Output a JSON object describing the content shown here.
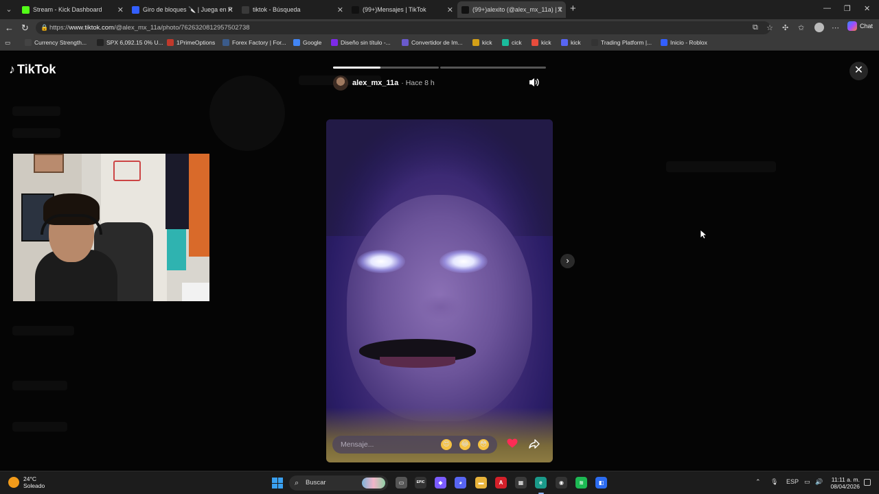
{
  "browser": {
    "tabs": [
      {
        "title": "Stream - Kick Dashboard",
        "icon": "kick-icon",
        "color": "#53fc18"
      },
      {
        "title": "Giro de bloques 🔪 | Juega en Ro",
        "icon": "roblox-icon",
        "color": "#335fff"
      },
      {
        "title": "tiktok - Búsqueda",
        "icon": "search-icon",
        "color": "#3a3a3a"
      },
      {
        "title": "(99+)Mensajes | TikTok",
        "icon": "tiktok-icon",
        "color": "#111111"
      },
      {
        "title": "(99+)alexito (@alex_mx_11a) | Tik",
        "icon": "tiktok-icon",
        "color": "#111111"
      }
    ],
    "active_tab": 4,
    "url_prefix": "https://",
    "url_host": "www.tiktok.com",
    "url_path": "/@alex_mx_11a/photo/7626320812957502738",
    "copilot_label": "Chat",
    "bookmarks": [
      {
        "label": "Currency Strength...",
        "icon": "lc-icon",
        "color": "#444"
      },
      {
        "label": "SPX 6,092.15 0% U...",
        "icon": "tradingview-icon",
        "color": "#222"
      },
      {
        "label": "1PrimeOptions",
        "icon": "primeoptions-icon",
        "color": "#c0392b"
      },
      {
        "label": "Forex Factory | For...",
        "icon": "forexfactory-icon",
        "color": "#3b5b8a"
      },
      {
        "label": "Google",
        "icon": "google-icon",
        "color": "#4285f4"
      },
      {
        "label": "Diseño sin título -...",
        "icon": "canva-icon",
        "color": "#7d2ae8"
      },
      {
        "label": "Convertidor de Im...",
        "icon": "converter-icon",
        "color": "#6a5acd"
      },
      {
        "label": "kick",
        "icon": "kick-icon",
        "color": "#d4a017"
      },
      {
        "label": "cick",
        "icon": "kick-icon",
        "color": "#1abc9c"
      },
      {
        "label": "kick",
        "icon": "kick-icon",
        "color": "#e74c3c"
      },
      {
        "label": "kick",
        "icon": "kick-icon",
        "color": "#5865f2"
      },
      {
        "label": "Trading Platform |...",
        "icon": "trading-platform-icon",
        "color": "#333"
      },
      {
        "label": "Inicio - Roblox",
        "icon": "roblox-icon",
        "color": "#335fff"
      }
    ]
  },
  "tiktok": {
    "logo_text": "TikTok",
    "story": {
      "username": "alex_mx_11a",
      "time": "· Hace 8 h",
      "progress": [
        1.0,
        0.0
      ],
      "first_segment_progress": 0.45,
      "message_placeholder": "Mensaje...",
      "emojis": [
        "😍",
        "😂",
        "😳"
      ]
    }
  },
  "taskbar": {
    "temperature": "24°C",
    "weather": "Soleado",
    "search_label": "Buscar",
    "language": "ESP",
    "time": "11:11 a. m.",
    "date": "08/04/2026",
    "apps": [
      {
        "name": "file-explorer-tb-icon",
        "glyph": "▭",
        "color": "#555"
      },
      {
        "name": "epic-games-tb-icon",
        "glyph": "EPIC",
        "color": "#333"
      },
      {
        "name": "copilot-tb-icon",
        "glyph": "◆",
        "color": "#7b5cff"
      },
      {
        "name": "discord-tb-icon",
        "glyph": "◕",
        "color": "#5865f2"
      },
      {
        "name": "folder-tb-icon",
        "glyph": "▬",
        "color": "#e8b33a"
      },
      {
        "name": "adobe-tb-icon",
        "glyph": "A",
        "color": "#d4202a"
      },
      {
        "name": "store-tb-icon",
        "glyph": "▦",
        "color": "#3a3a3a"
      },
      {
        "name": "edge-tb-icon",
        "glyph": "e",
        "color": "#1a9a8a"
      },
      {
        "name": "obs-tb-icon",
        "glyph": "◉",
        "color": "#333"
      },
      {
        "name": "spotify-tb-icon",
        "glyph": "≋",
        "color": "#1db954"
      },
      {
        "name": "roblox-studio-tb-icon",
        "glyph": "◧",
        "color": "#2c6cf0"
      }
    ]
  }
}
